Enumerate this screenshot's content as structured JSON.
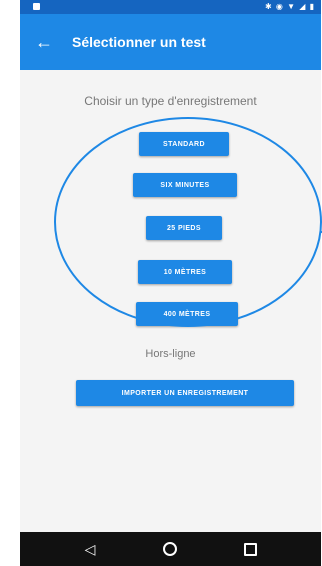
{
  "app_bar": {
    "title": "Sélectionner un test"
  },
  "main": {
    "subtitle": "Choisir un type d'enregistrement",
    "buttons": [
      {
        "label": "STANDARD"
      },
      {
        "label": "SIX MINUTES"
      },
      {
        "label": "25 PIEDS"
      },
      {
        "label": "10 MÈTRES"
      },
      {
        "label": "400 MÈTRES"
      }
    ],
    "offline_label": "Hors-ligne",
    "import_button_label": "IMPORTER UN ENREGISTREMENT"
  },
  "icons": {
    "back": "back-arrow-icon",
    "nav_back": "triangle-back-icon",
    "nav_home": "circle-home-icon",
    "nav_recents": "square-recents-icon"
  },
  "colors": {
    "app_bar": "#1e88e5",
    "status_bar": "#1565c0",
    "annotation": "#1e88e5"
  }
}
